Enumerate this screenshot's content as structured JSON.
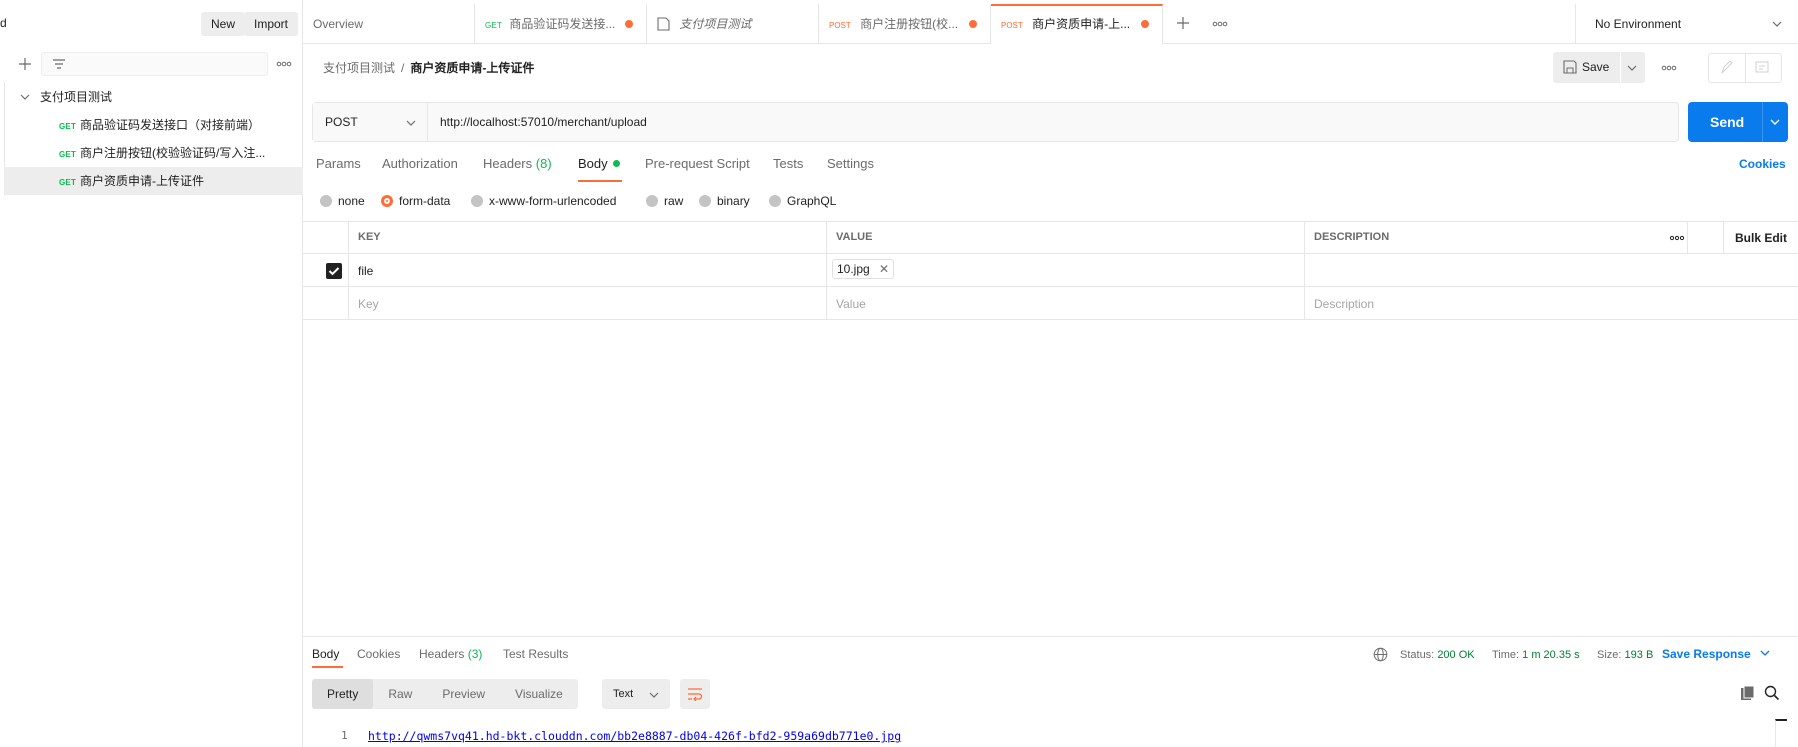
{
  "sidebar": {
    "workspace_name": "d",
    "new_label": "New",
    "import_label": "Import",
    "collection_name": "支付项目测试",
    "requests": [
      {
        "method": "GET",
        "name": "商品验证码发送接口（对接前端）"
      },
      {
        "method": "GET",
        "name": "商户注册按钮(校验验证码/写入注..."
      },
      {
        "method": "GET",
        "name": "商户资质申请-上传证件"
      }
    ]
  },
  "tabs": [
    {
      "method": "",
      "label": "Overview",
      "unsaved": false
    },
    {
      "method": "GET",
      "label": "商品验证码发送接...",
      "unsaved": true
    },
    {
      "method": "",
      "label": "支付项目测试",
      "unsaved": false
    },
    {
      "method": "POST",
      "label": "商户注册按钮(校...",
      "unsaved": true
    },
    {
      "method": "POST",
      "label": "商户资质申请-上...",
      "unsaved": true
    }
  ],
  "environment": "No Environment",
  "breadcrumb": {
    "parent": "支付项目测试",
    "separator": "/",
    "current": "商户资质申请-上传证件"
  },
  "save_label": "Save",
  "request": {
    "method": "POST",
    "url": "http://localhost:57010/merchant/upload",
    "send_label": "Send",
    "tabs": [
      {
        "label": "Params"
      },
      {
        "label": "Authorization"
      },
      {
        "label": "Headers",
        "count": "(8)"
      },
      {
        "label": "Body"
      },
      {
        "label": "Pre-request Script"
      },
      {
        "label": "Tests"
      },
      {
        "label": "Settings"
      }
    ],
    "cookies_label": "Cookies",
    "body_modes": [
      "none",
      "form-data",
      "x-www-form-urlencoded",
      "raw",
      "binary",
      "GraphQL"
    ],
    "selected_body_mode": "form-data"
  },
  "form_table": {
    "headers": {
      "key": "KEY",
      "value": "VALUE",
      "description": "DESCRIPTION",
      "bulk_edit": "Bulk Edit"
    },
    "rows": [
      {
        "key": "file",
        "value": "10.jpg",
        "description": "",
        "checked": true
      }
    ],
    "placeholders": {
      "key": "Key",
      "value": "Value",
      "description": "Description"
    }
  },
  "response": {
    "tabs": [
      {
        "label": "Body"
      },
      {
        "label": "Cookies"
      },
      {
        "label": "Headers",
        "count": "(3)"
      },
      {
        "label": "Test Results"
      }
    ],
    "status_label": "Status:",
    "status_value": "200 OK",
    "time_label": "Time:",
    "time_value": "1 m 20.35 s",
    "size_label": "Size:",
    "size_value": "193 B",
    "save_response_label": "Save Response",
    "view_modes": [
      "Pretty",
      "Raw",
      "Preview",
      "Visualize"
    ],
    "format": "Text",
    "line_number": "1",
    "body_line": "http://qwms7vq41.hd-bkt.clouddn.com/bb2e8887-db04-426f-bfd2-959a69db771e0.jpg"
  },
  "colors": {
    "accent": "#ff6c37",
    "send": "#097bed",
    "get": "#0cbb52",
    "status_ok": "#007f31"
  }
}
